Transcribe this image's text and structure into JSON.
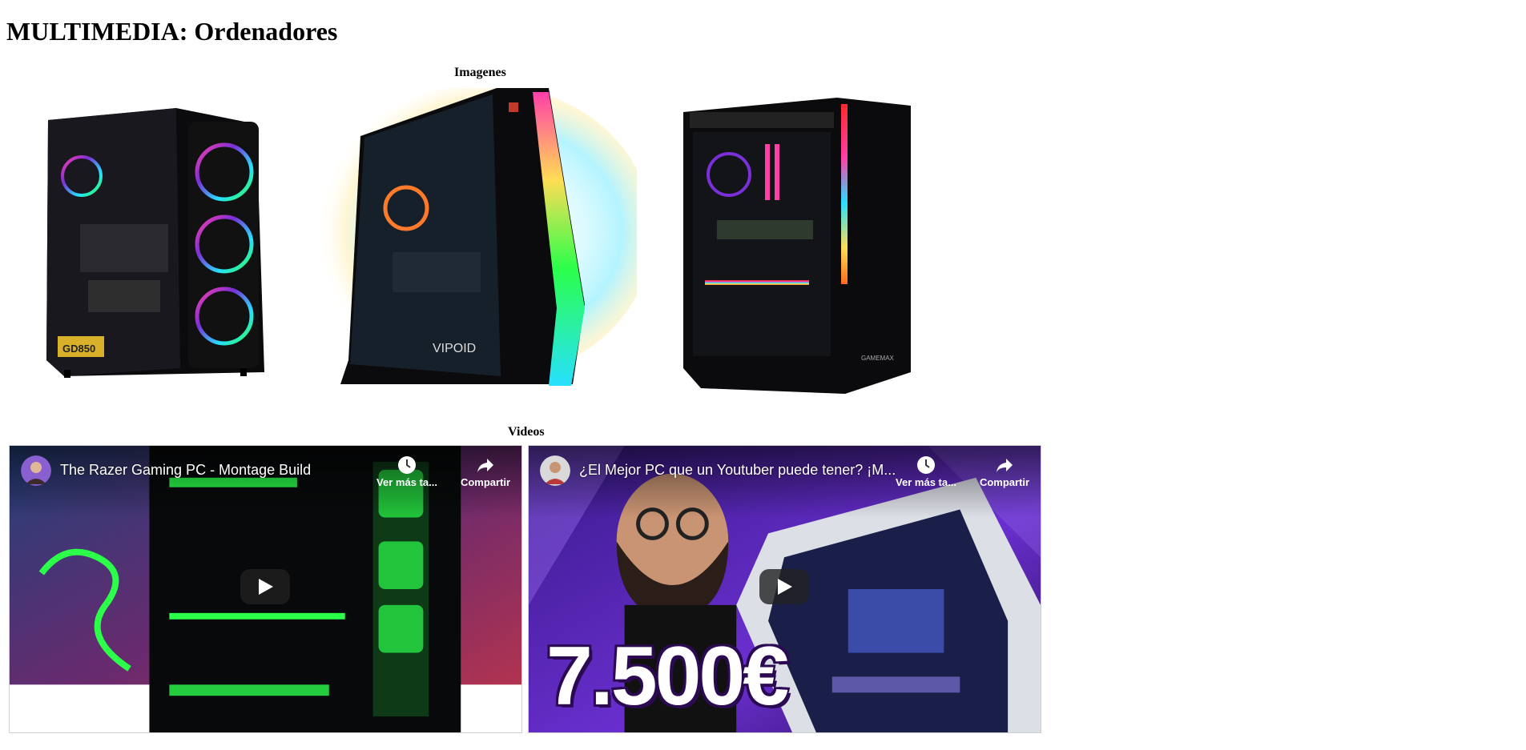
{
  "page": {
    "title": "MULTIMEDIA: Ordenadores"
  },
  "images_section": {
    "caption": "Imagenes",
    "items": [
      {
        "icon": "pc-case-ring-fans-image",
        "label": "GD850"
      },
      {
        "icon": "pc-case-rgb-glow-image",
        "label": "VIPOID"
      },
      {
        "icon": "pc-case-rgb-strip-image",
        "label": "GAMEMAX"
      }
    ]
  },
  "videos_section": {
    "caption": "Videos",
    "items": [
      {
        "title": "The Razer Gaming PC - Montage Build",
        "watch_later_label": "Ver más ta...",
        "share_label": "Compartir",
        "overlay_text": ""
      },
      {
        "title": "¿El Mejor PC que un Youtuber puede tener? ¡M...",
        "watch_later_label": "Ver más ta...",
        "share_label": "Compartir",
        "overlay_text": "7.500€"
      }
    ]
  },
  "colors": {
    "rgb_green": "#2bff4a",
    "rgb_purple": "#7a2fd8",
    "rgb_pink": "#ff3fa8",
    "rgb_cyan": "#27e0ff",
    "case_black": "#0b0b0d"
  }
}
